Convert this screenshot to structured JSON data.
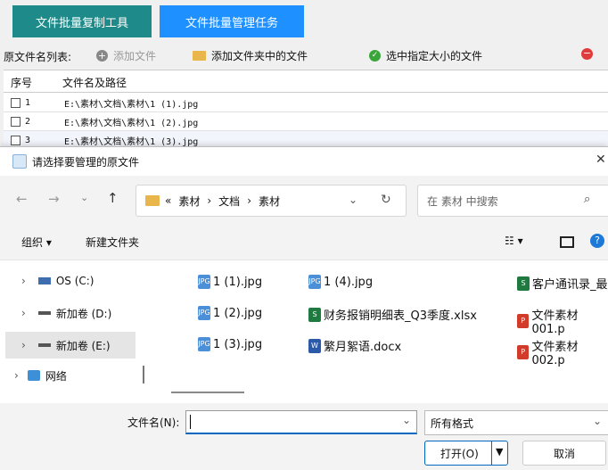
{
  "tabs": [
    "文件批量复制工具",
    "文件批量管理任务"
  ],
  "toolbar": {
    "list_label": "原文件名列表:",
    "add_file": "添加文件",
    "add_folder_files": "添加文件夹中的文件",
    "select_by_size": "选中指定大小的文件"
  },
  "grid": {
    "col_index": "序号",
    "col_path": "文件名及路径",
    "rows": [
      {
        "index": "1",
        "path": "E:\\素材\\文档\\素材\\1 (1).jpg"
      },
      {
        "index": "2",
        "path": "E:\\素材\\文档\\素材\\1 (2).jpg"
      },
      {
        "index": "3",
        "path": "E:\\素材\\文档\\素材\\1 (3).jpg"
      }
    ]
  },
  "dialog": {
    "title": "请选择要管理的原文件",
    "breadcrumb": [
      "«",
      "素材",
      "文档",
      "素材"
    ],
    "search_placeholder": "在 素材 中搜索",
    "organize": "组织",
    "new_folder": "新建文件夹",
    "nav_items": [
      "OS (C:)",
      "新加卷 (D:)",
      "新加卷 (E:)",
      "网络"
    ],
    "files_col1": [
      "1 (1).jpg",
      "1 (2).jpg",
      "1 (3).jpg"
    ],
    "files_col2": [
      "1 (4).jpg",
      "财务报销明细表_Q3季度.xlsx",
      "繁月絮语.docx"
    ],
    "files_col3": [
      "客户通讯录_最",
      "文件素材001.p",
      "文件素材002.p"
    ],
    "filename_label": "文件名(N):",
    "filename_value": "",
    "file_type": "所有格式",
    "open_button": "打开(O)",
    "cancel_button": "取消"
  },
  "colors": {
    "tab1": "#1e8b8a",
    "tab2": "#1e90ff",
    "accent": "#0067c0",
    "jpg_icon": "#4a8fd8",
    "xlsx_icon": "#1f7a3f",
    "docx_icon": "#2b5aa8",
    "pdf_icon": "#d23a2a"
  }
}
